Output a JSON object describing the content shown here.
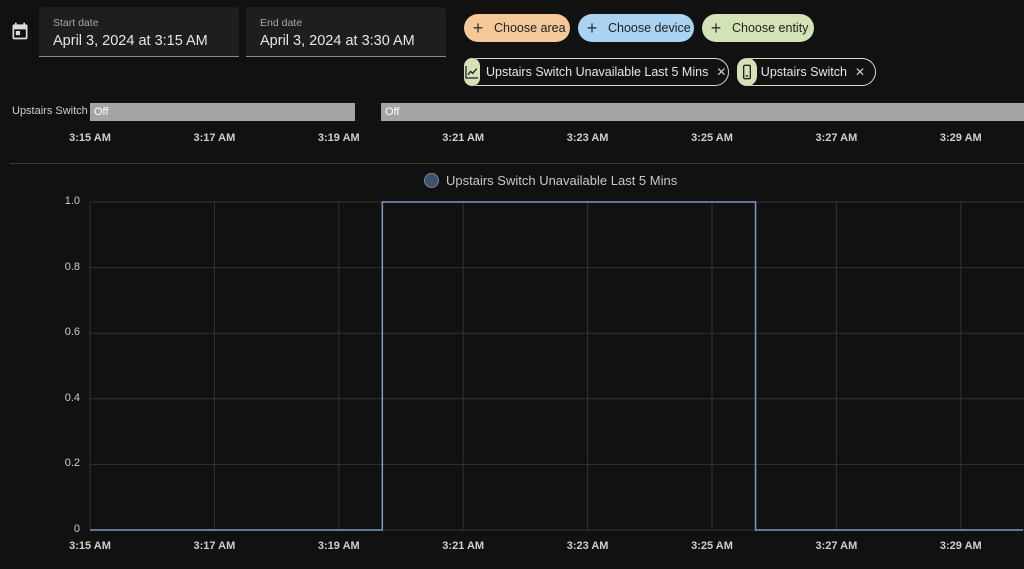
{
  "date_range": {
    "start_label": "Start date",
    "start_value": "April 3, 2024 at 3:15 AM",
    "end_label": "End date",
    "end_value": "April 3, 2024 at 3:30 AM"
  },
  "pickers": {
    "area": "Choose area",
    "device": "Choose device",
    "entity": "Choose entity"
  },
  "selected": [
    {
      "label": "Upstairs Switch Unavailable Last 5 Mins",
      "icon": "chart-line-icon"
    },
    {
      "label": "Upstairs Switch",
      "icon": "phone-device-icon"
    }
  ],
  "colors": {
    "area_chip": "#f5c89a",
    "device_chip": "#a9d3f0",
    "entity_chip": "#d4e3b5",
    "series_line": "#7c9bc0",
    "timeline_bar": "#a5a5a5"
  },
  "timeline": {
    "entity": "Upstairs Switch",
    "segments": [
      {
        "state": "Off",
        "start": "3:15 AM",
        "end": "3:19:42 AM"
      },
      {
        "state": "Off",
        "start": "3:20:05 AM",
        "end": "3:30 AM"
      }
    ],
    "ticks": [
      "3:15 AM",
      "3:17 AM",
      "3:19 AM",
      "3:21 AM",
      "3:23 AM",
      "3:25 AM",
      "3:27 AM",
      "3:29 AM"
    ]
  },
  "chart_data": {
    "type": "line",
    "title": "",
    "legend": "Upstairs Switch Unavailable Last 5 Mins",
    "legend_position": "top-center",
    "xlabel": "",
    "ylabel": "",
    "x_ticks": [
      "3:15 AM",
      "3:17 AM",
      "3:19 AM",
      "3:21 AM",
      "3:23 AM",
      "3:25 AM",
      "3:27 AM",
      "3:29 AM"
    ],
    "y_ticks": [
      "1.0",
      "0.8",
      "0.6",
      "0.4",
      "0.2",
      "0"
    ],
    "ylim": [
      0,
      1
    ],
    "grid": true,
    "series": [
      {
        "name": "Upstairs Switch Unavailable Last 5 Mins",
        "step": true,
        "points": [
          {
            "x": "3:15:00 AM",
            "y": 0
          },
          {
            "x": "3:19:42 AM",
            "y": 0
          },
          {
            "x": "3:19:42 AM",
            "y": 1
          },
          {
            "x": "3:25:42 AM",
            "y": 1
          },
          {
            "x": "3:25:42 AM",
            "y": 0
          },
          {
            "x": "3:30:00 AM",
            "y": 0
          }
        ]
      }
    ]
  }
}
